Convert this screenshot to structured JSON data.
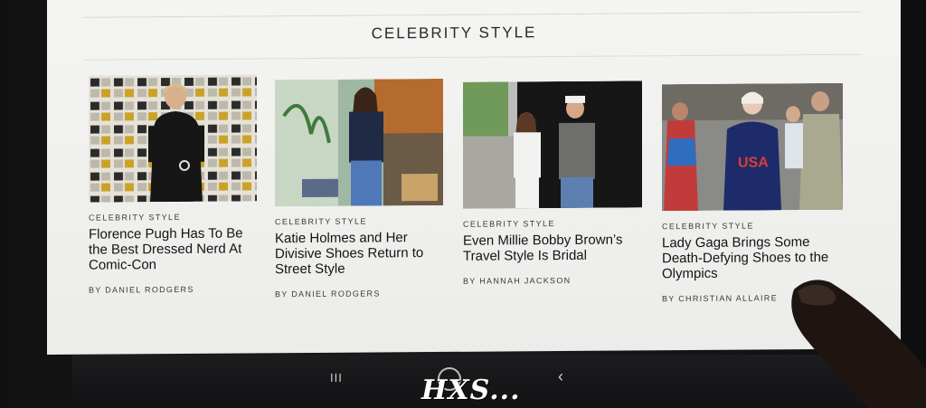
{
  "section": {
    "title": "CELEBRITY STYLE"
  },
  "cards": [
    {
      "kicker": "CELEBRITY STYLE",
      "headline": "Florence Pugh Has To Be the Best Dressed Nerd At Comic-Con",
      "byline": "BY DANIEL RODGERS",
      "image": "celebrity-photo-comic-con-backdrop"
    },
    {
      "kicker": "CELEBRITY STYLE",
      "headline": "Katie Holmes and Her Divisive Shoes Return to Street Style",
      "byline": "BY DANIEL RODGERS",
      "image": "celebrity-photo-street-style"
    },
    {
      "kicker": "CELEBRITY STYLE",
      "headline": "Even Millie Bobby Brown’s Travel Style Is Bridal",
      "byline": "BY HANNAH JACKSON",
      "image": "celebrity-photo-couple-walking"
    },
    {
      "kicker": "CELEBRITY STYLE",
      "headline": "Lady Gaga Brings Some Death-Defying Shoes to the Olympics",
      "byline": "BY CHRISTIAN ALLAIRE",
      "image": "celebrity-photo-olympics-crowd"
    }
  ],
  "navbar": {
    "recent_icon": "recent-apps-icon",
    "recent_glyph": "III",
    "home_icon": "home-icon",
    "back_icon": "back-icon",
    "back_glyph": "‹"
  },
  "watermark": {
    "text": "HXS..."
  },
  "colors": {
    "screen_bg": "#f0f0ee",
    "text_dark": "#141414",
    "text_meta": "#3a3a3a"
  }
}
